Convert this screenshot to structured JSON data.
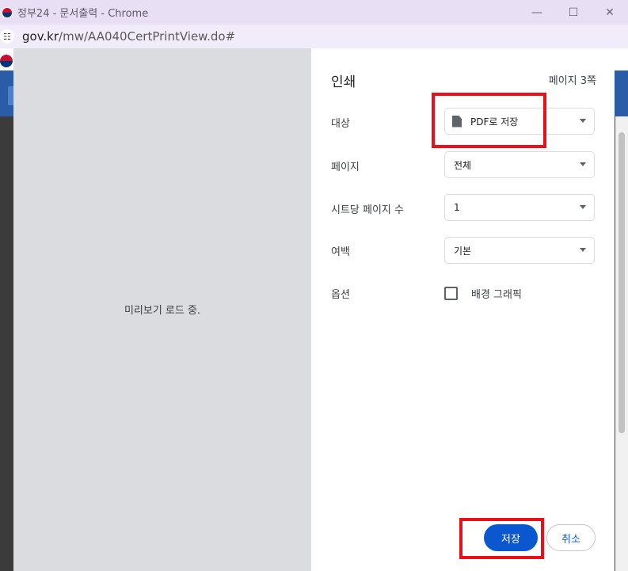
{
  "window": {
    "title": "정부24 - 문서출력 - Chrome",
    "minimize_glyph": "—",
    "maximize_glyph": "☐",
    "close_glyph": "✕",
    "icons": [
      "gov-logo-icon",
      "minimize-icon",
      "maximize-icon",
      "close-icon"
    ]
  },
  "address": {
    "host": "gov.kr",
    "path": "/mw/AA040CertPrintView.do#",
    "site_info_glyph": "☷"
  },
  "preview": {
    "loading_text": "미리보기 로드 중."
  },
  "print": {
    "title": "인쇄",
    "page_count": "페이지 3쪽",
    "destination": {
      "label": "대상",
      "value": "PDF로 저장",
      "icon": "file-icon"
    },
    "pages": {
      "label": "페이지",
      "value": "전체"
    },
    "pages_per_sheet": {
      "label": "시트당 페이지 수",
      "value": "1"
    },
    "margins": {
      "label": "여백",
      "value": "기본"
    },
    "options": {
      "label": "옵션",
      "background_graphics": "배경 그래픽",
      "background_graphics_checked": false
    },
    "save_button": "저장",
    "cancel_button": "취소"
  },
  "colors": {
    "primary": "#0b57d0",
    "highlight": "#e8101b",
    "titlebar": "#e8dff5",
    "preview_bg": "#dadce0"
  }
}
